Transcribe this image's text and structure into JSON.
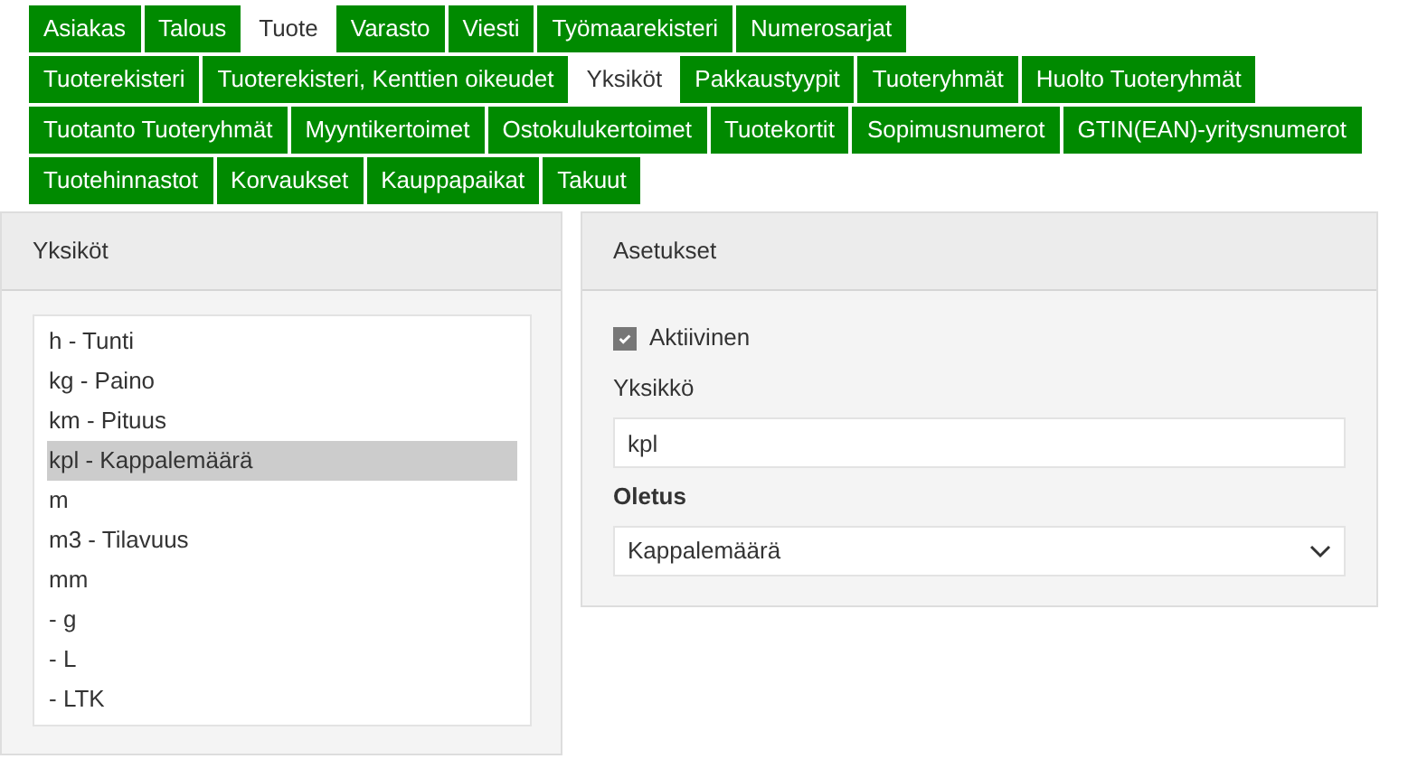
{
  "tab_rows": [
    [
      {
        "label": "Asiakas",
        "selected": false
      },
      {
        "label": "Talous",
        "selected": false
      },
      {
        "label": "Tuote",
        "selected": true
      },
      {
        "label": "Varasto",
        "selected": false
      },
      {
        "label": "Viesti",
        "selected": false
      },
      {
        "label": "Työmaarekisteri",
        "selected": false
      },
      {
        "label": "Numerosarjat",
        "selected": false
      }
    ],
    [
      {
        "label": "Tuoterekisteri",
        "selected": false
      },
      {
        "label": "Tuoterekisteri, Kenttien oikeudet",
        "selected": false
      },
      {
        "label": "Yksiköt",
        "selected": true
      },
      {
        "label": "Pakkaustyypit",
        "selected": false
      },
      {
        "label": "Tuoteryhmät",
        "selected": false
      },
      {
        "label": "Huolto Tuoteryhmät",
        "selected": false
      }
    ],
    [
      {
        "label": "Tuotanto Tuoteryhmät",
        "selected": false
      },
      {
        "label": "Myyntikertoimet",
        "selected": false
      },
      {
        "label": "Ostokulukertoimet",
        "selected": false
      },
      {
        "label": "Tuotekortit",
        "selected": false
      },
      {
        "label": "Sopimusnumerot",
        "selected": false
      },
      {
        "label": "GTIN(EAN)-yritysnumerot",
        "selected": false
      }
    ],
    [
      {
        "label": "Tuotehinnastot",
        "selected": false
      },
      {
        "label": "Korvaukset",
        "selected": false
      },
      {
        "label": "Kauppapaikat",
        "selected": false
      },
      {
        "label": "Takuut",
        "selected": false
      }
    ]
  ],
  "units_panel": {
    "title": "Yksiköt",
    "items": [
      {
        "label": "h - Tunti",
        "selected": false
      },
      {
        "label": "kg - Paino",
        "selected": false
      },
      {
        "label": "km - Pituus",
        "selected": false
      },
      {
        "label": "kpl - Kappalemäärä",
        "selected": true
      },
      {
        "label": "m",
        "selected": false
      },
      {
        "label": "m3 - Tilavuus",
        "selected": false
      },
      {
        "label": "mm",
        "selected": false
      },
      {
        "label": "- g",
        "selected": false
      },
      {
        "label": "- L",
        "selected": false
      },
      {
        "label": "- LTK",
        "selected": false
      }
    ]
  },
  "settings_panel": {
    "title": "Asetukset",
    "active": {
      "label": "Aktiivinen",
      "checked": true
    },
    "unit": {
      "label": "Yksikkö",
      "value": "kpl"
    },
    "default": {
      "label": "Oletus",
      "value": "Kappalemäärä"
    }
  }
}
